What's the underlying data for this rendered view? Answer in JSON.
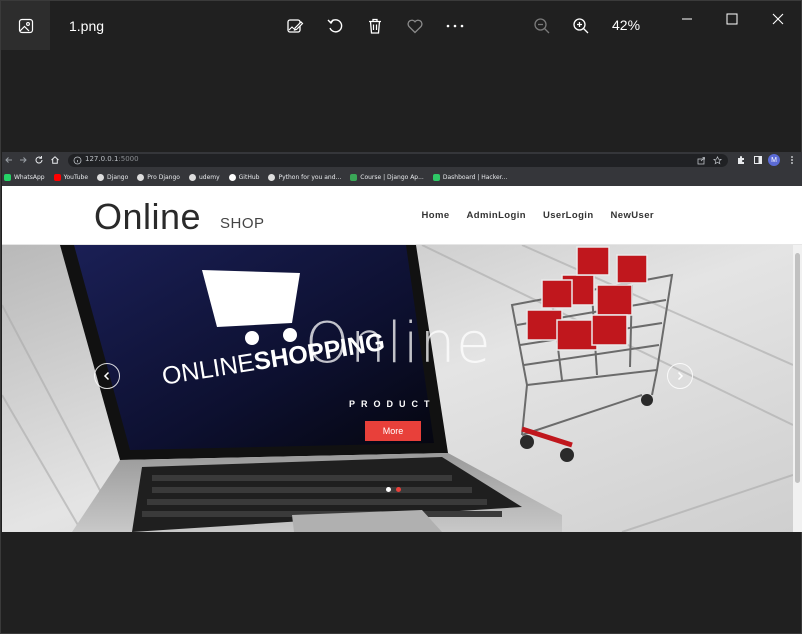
{
  "viewer": {
    "filename": "1.png",
    "zoom": "42%",
    "toolbar_icons": [
      "edit-image-icon",
      "rotate-icon",
      "delete-icon",
      "favorite-icon",
      "more-icon"
    ],
    "zoom_icons": [
      "zoom-out-icon",
      "zoom-in-icon"
    ]
  },
  "browser": {
    "url_host": "127.0.0.1",
    "url_port": ":5000",
    "bookmarks": [
      {
        "label": "WhatsApp",
        "color": "#25d366"
      },
      {
        "label": "YouTube",
        "color": "#ff0000"
      },
      {
        "label": "Django",
        "color": "#dddddd"
      },
      {
        "label": "Pro Django",
        "color": "#dddddd"
      },
      {
        "label": "udemy",
        "color": "#dddddd"
      },
      {
        "label": "GitHub",
        "color": "#ffffff"
      },
      {
        "label": "Python for you and...",
        "color": "#dddddd"
      },
      {
        "label": "Course | Django Ap...",
        "color": "#3aa757"
      },
      {
        "label": "Dashboard | Hacker...",
        "color": "#2ec866"
      }
    ],
    "profile_initial": "M"
  },
  "site": {
    "brand": "Online",
    "brand_sub": "SHOP",
    "nav": [
      "Home",
      "AdminLogin",
      "UserLogin",
      "NewUser"
    ],
    "hero": {
      "title": "Online",
      "subtitle": "PRODUCT",
      "button": "More",
      "laptop_text_light": "ONLINE",
      "laptop_text_bold": "SHOPPING",
      "active_slide": 1,
      "slide_count": 2
    },
    "colors": {
      "accent": "#e8403a"
    }
  }
}
